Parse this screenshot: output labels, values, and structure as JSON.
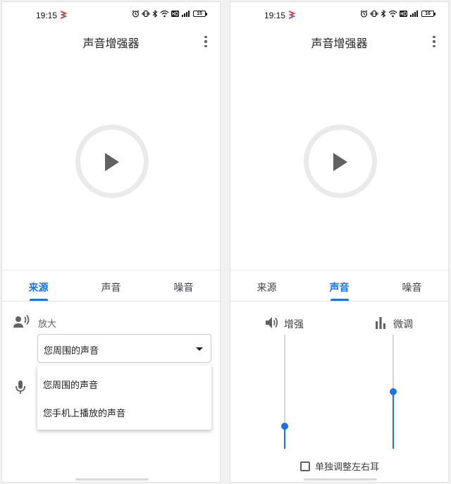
{
  "colors": {
    "accent": "#1a73e8",
    "track": "#d5d5d5",
    "icon": "#5f6368"
  },
  "screens": [
    {
      "status": {
        "time": "19:15",
        "battery": "15"
      },
      "app_title": "声音增强器",
      "tabs": [
        {
          "label": "来源"
        },
        {
          "label": "声音"
        },
        {
          "label": "噪音"
        }
      ],
      "active_tab": 0,
      "source": {
        "amplify_label": "放大",
        "selected": "您周围的声音",
        "options": [
          "您周围的声音",
          "您手机上播放的声音"
        ]
      }
    },
    {
      "status": {
        "time": "19:15",
        "battery": "16"
      },
      "app_title": "声音增强器",
      "tabs": [
        {
          "label": "来源"
        },
        {
          "label": "声音"
        },
        {
          "label": "噪音"
        }
      ],
      "active_tab": 1,
      "sound": {
        "boost_label": "增强",
        "fine_tune_label": "微调",
        "boost_level": 0.2,
        "fine_tune_level": 0.5,
        "separate_ears_label": "单独调整左右耳",
        "separate_ears_checked": false
      }
    }
  ]
}
